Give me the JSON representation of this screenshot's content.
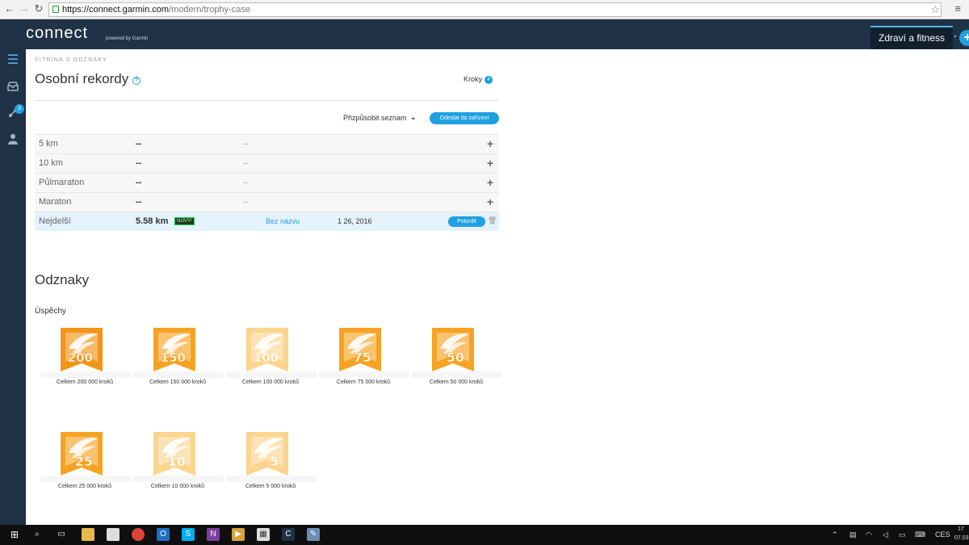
{
  "browser": {
    "url_host": "https://connect.garmin.com",
    "url_path": "/modern/trophy-case"
  },
  "header": {
    "logo": "connect",
    "logo_sub": "powered by Garmin",
    "tab_label": "Zdraví a fitness"
  },
  "sidebar": {
    "badge_count": "3"
  },
  "page": {
    "breadcrumb": "VITRÍNA S ODZNAKY",
    "title": "Osobní rekordy",
    "kroky_label": "Kroky",
    "kroky_count": "4",
    "customize_label": "Přizpůsobit seznam",
    "send_button": "Odeslat do zařízení"
  },
  "records": [
    {
      "name": "5 km",
      "value": "--",
      "sub": "--"
    },
    {
      "name": "10 km",
      "value": "--",
      "sub": "--"
    },
    {
      "name": "Půlmaraton",
      "value": "--",
      "sub": "--"
    },
    {
      "name": "Maraton",
      "value": "--",
      "sub": "--"
    }
  ],
  "longest": {
    "name": "Nejdelší",
    "value": "5.58 km",
    "new_badge": "NOVÝ!",
    "activity": "Bez názvu",
    "date": "1 26, 2016",
    "confirm": "Potvrdit"
  },
  "badges_section": {
    "title": "Odznaky",
    "subtitle": "Úspěchy"
  },
  "badges": [
    {
      "num": "200",
      "label": "Celkem 200 000 kroků",
      "color": "#f29418"
    },
    {
      "num": "150",
      "label": "Celkem 150 000 kroků",
      "color": "#f6a323"
    },
    {
      "num": "100",
      "label": "Celkem 100 000 kroků",
      "color": "#fbd48f"
    },
    {
      "num": "75",
      "label": "Celkem 75 000 kroků",
      "color": "#f6a323"
    },
    {
      "num": "50",
      "label": "Celkem 50 000 kroků",
      "color": "#f6a323"
    },
    {
      "num": "25",
      "label": "Celkem 25 000 kroků",
      "color": "#f6a323"
    },
    {
      "num": "10",
      "label": "Celkem 10 000 kroků",
      "color": "#fbd48f"
    },
    {
      "num": "5",
      "label": "Celkem 5 000 kroků",
      "color": "#fbd48f"
    }
  ],
  "taskbar": {
    "lang": "CES",
    "time": "17",
    "date": "07.03"
  }
}
